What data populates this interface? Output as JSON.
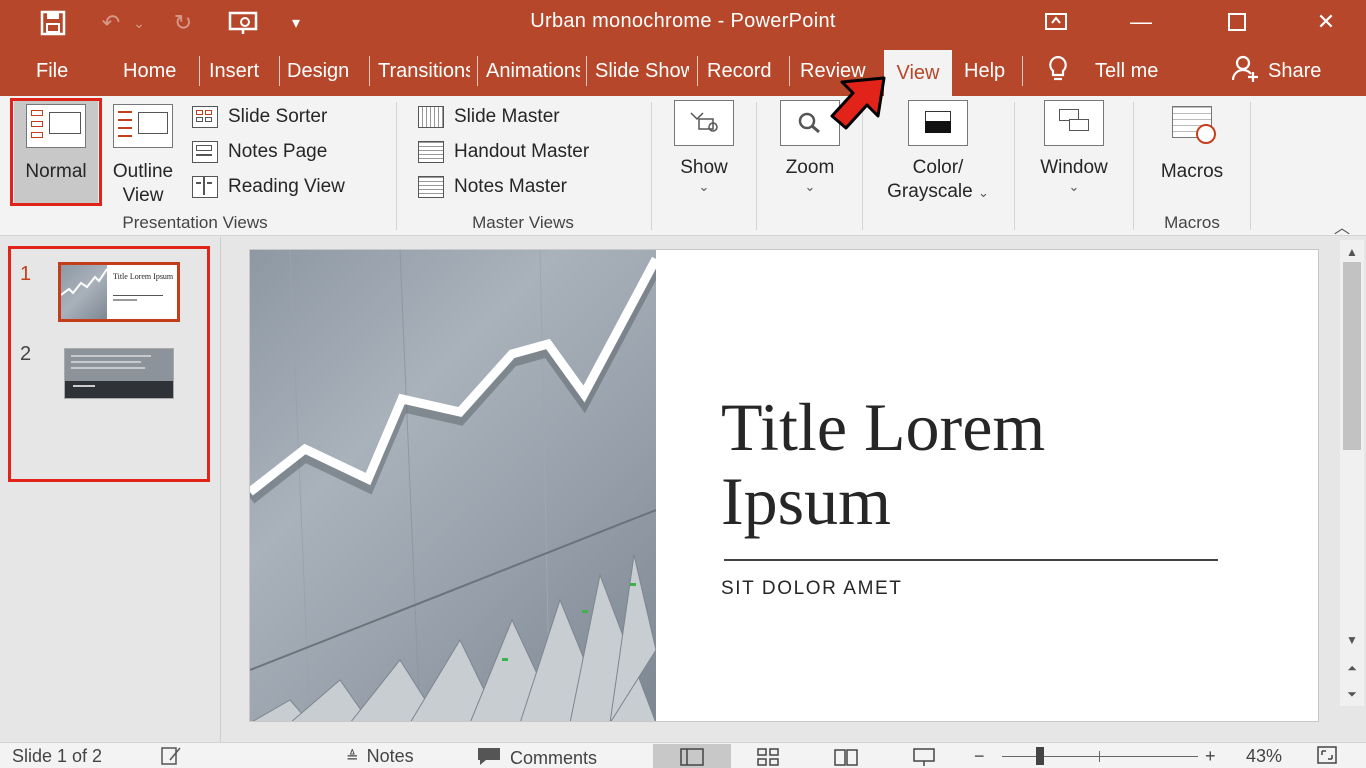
{
  "app": {
    "window_title": "Urban monochrome  -  PowerPoint",
    "brand_color": "#b7472a"
  },
  "quick_access": [
    {
      "icon": "save-icon",
      "glyph": "💾"
    },
    {
      "icon": "undo-icon",
      "glyph": "↶"
    },
    {
      "icon": "undo-dropdown-icon",
      "glyph": "⌄"
    },
    {
      "icon": "redo-icon",
      "glyph": "↻"
    },
    {
      "icon": "present-from-beginning-icon",
      "glyph": "⊡"
    },
    {
      "icon": "customize-qat-icon",
      "glyph": "▾"
    }
  ],
  "window_controls": [
    {
      "icon": "ribbon-display-options-icon",
      "glyph": "⊡"
    },
    {
      "icon": "minimize-icon",
      "glyph": "—"
    },
    {
      "icon": "maximize-icon",
      "glyph": "☐"
    },
    {
      "icon": "close-icon",
      "glyph": "✕"
    }
  ],
  "tabs": [
    {
      "label": "File"
    },
    {
      "label": "Home"
    },
    {
      "label": "Insert"
    },
    {
      "label": "Design"
    },
    {
      "label": "Transitions"
    },
    {
      "label": "Animations"
    },
    {
      "label": "Slide Show"
    },
    {
      "label": "Record"
    },
    {
      "label": "Review"
    },
    {
      "label": "View",
      "active": true
    },
    {
      "label": "Help"
    }
  ],
  "tell_me": "Tell me",
  "share": "Share",
  "ribbon": {
    "presentation_views": {
      "label": "Presentation Views",
      "normal": "Normal",
      "outline_view": [
        "Outline",
        "View"
      ],
      "slide_sorter": "Slide Sorter",
      "notes_page": "Notes Page",
      "reading_view": "Reading View"
    },
    "master_views": {
      "label": "Master Views",
      "slide_master": "Slide Master",
      "handout_master": "Handout Master",
      "notes_master": "Notes Master"
    },
    "show": "Show",
    "zoom": "Zoom",
    "color_grayscale": [
      "Color/",
      "Grayscale"
    ],
    "window": "Window",
    "macros": {
      "button": "Macros",
      "label": "Macros"
    }
  },
  "thumbnails": [
    {
      "number": "1",
      "title": "Title Lorem Ipsum",
      "active": true
    },
    {
      "number": "2",
      "active": false
    }
  ],
  "slide": {
    "title_line1": "Title Lorem",
    "title_line2": "Ipsum",
    "subtitle": "SIT DOLOR AMET"
  },
  "status_bar": {
    "slide_indicator": "Slide 1 of 2",
    "notes": "Notes",
    "comments": "Comments",
    "zoom_level": "43%",
    "zoom_fraction": 0.43
  }
}
